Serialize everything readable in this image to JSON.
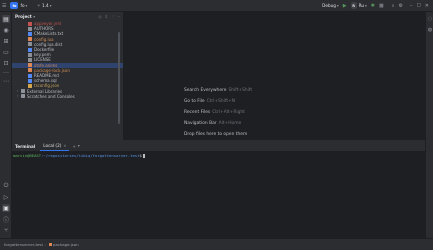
{
  "titlebar": {
    "project_badge": "fo",
    "project_name": "fo",
    "branch_icon": "branch-icon",
    "branch_name": "1.4",
    "run_config": "Debug",
    "run_tool": "Ru",
    "icons": [
      "hamburger-menu-icon",
      "branch-icon",
      "run-icon",
      "debug-icon",
      "stop-icon",
      "search-icon",
      "settings-icon",
      "minimize-icon",
      "maximize-icon",
      "close-icon"
    ]
  },
  "project_panel": {
    "title": "Project",
    "files": [
      {
        "name": "appveyor.yml",
        "color": "red"
      },
      {
        "name": "AUTHORS",
        "color": "plain"
      },
      {
        "name": "CMakeLists.txt",
        "color": "blue"
      },
      {
        "name": "config.lua",
        "color": "orange"
      },
      {
        "name": "config.lua.dist",
        "color": "plain"
      },
      {
        "name": "Dockerfile",
        "color": "blue"
      },
      {
        "name": "key.pem",
        "color": "plain"
      },
      {
        "name": "LICENSE",
        "color": "plain"
      },
      {
        "name": "otsfe.anims",
        "color": "orange"
      },
      {
        "name": "package-lock.json",
        "color": "orange"
      },
      {
        "name": "README.md",
        "color": "blue"
      },
      {
        "name": "schema.sql",
        "color": "blue"
      },
      {
        "name": "tsconfig.json",
        "color": "yellow"
      }
    ],
    "nodes": [
      {
        "name": "External Libraries"
      },
      {
        "name": "Scratches and Consoles"
      }
    ]
  },
  "editor_hints": [
    {
      "label": "Search Everywhere",
      "shortcut": "Shift+Shift"
    },
    {
      "label": "Go to File",
      "shortcut": "Ctrl+Shift+N"
    },
    {
      "label": "Recent Files",
      "shortcut": "Ctrl+Alt+Right"
    },
    {
      "label": "Navigation Bar",
      "shortcut": "Alt+Home"
    },
    {
      "label": "Drop files here to open them",
      "shortcut": ""
    }
  ],
  "terminal": {
    "title": "Terminal",
    "tab_label": "Local (2)",
    "prompt_user": "marcin@BEAST",
    "prompt_path": ":~/repositories/tibia/forgottenserver-test",
    "prompt_symbol": "$"
  },
  "statusbar": {
    "crumb_1": "forgottenserver-test",
    "crumb_2": "package.json"
  }
}
